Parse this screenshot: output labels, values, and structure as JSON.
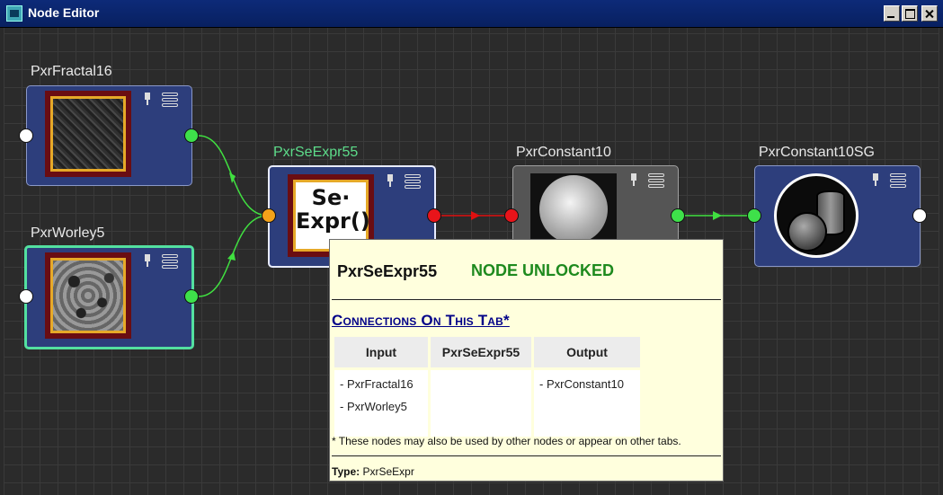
{
  "window": {
    "title": "Node Editor",
    "icon": "node-editor-app-icon"
  },
  "nodes": [
    {
      "id": "fractal",
      "name": "PxrFractal16",
      "icons": [
        "pin-icon",
        "menu-icon"
      ]
    },
    {
      "id": "worley",
      "name": "PxrWorley5",
      "icons": [
        "pin-icon",
        "menu-icon"
      ]
    },
    {
      "id": "seexpr",
      "name": "PxrSeExpr55",
      "thumb_text_line1": "Se·",
      "thumb_text_line2": "Expr()",
      "icons": [
        "pin-icon",
        "menu-icon"
      ]
    },
    {
      "id": "constant",
      "name": "PxrConstant10",
      "icons": [
        "pin-icon",
        "menu-icon"
      ]
    },
    {
      "id": "sg",
      "name": "PxrConstant10SG",
      "icons": [
        "pin-icon",
        "menu-icon"
      ]
    }
  ],
  "colors": {
    "node_blue": "#2d3e7c",
    "node_gray": "#555555",
    "selected_label": "#5ddc8a",
    "wire_green": "#40e040",
    "wire_red": "#e01010",
    "unlocked": "#1e8a1e"
  },
  "tooltip": {
    "node_name": "PxrSeExpr55",
    "status": "NODE UNLOCKED",
    "heading": "Connections On This Tab*",
    "columns": [
      "Input",
      "PxrSeExpr55",
      "Output"
    ],
    "inputs": [
      "- PxrFractal16",
      "- PxrWorley5"
    ],
    "node_cell": "",
    "outputs": [
      "- PxrConstant10"
    ],
    "note": "* These nodes may also be used by other nodes or appear on other tabs.",
    "type_label": "Type:",
    "type_value": "PxrSeExpr"
  }
}
